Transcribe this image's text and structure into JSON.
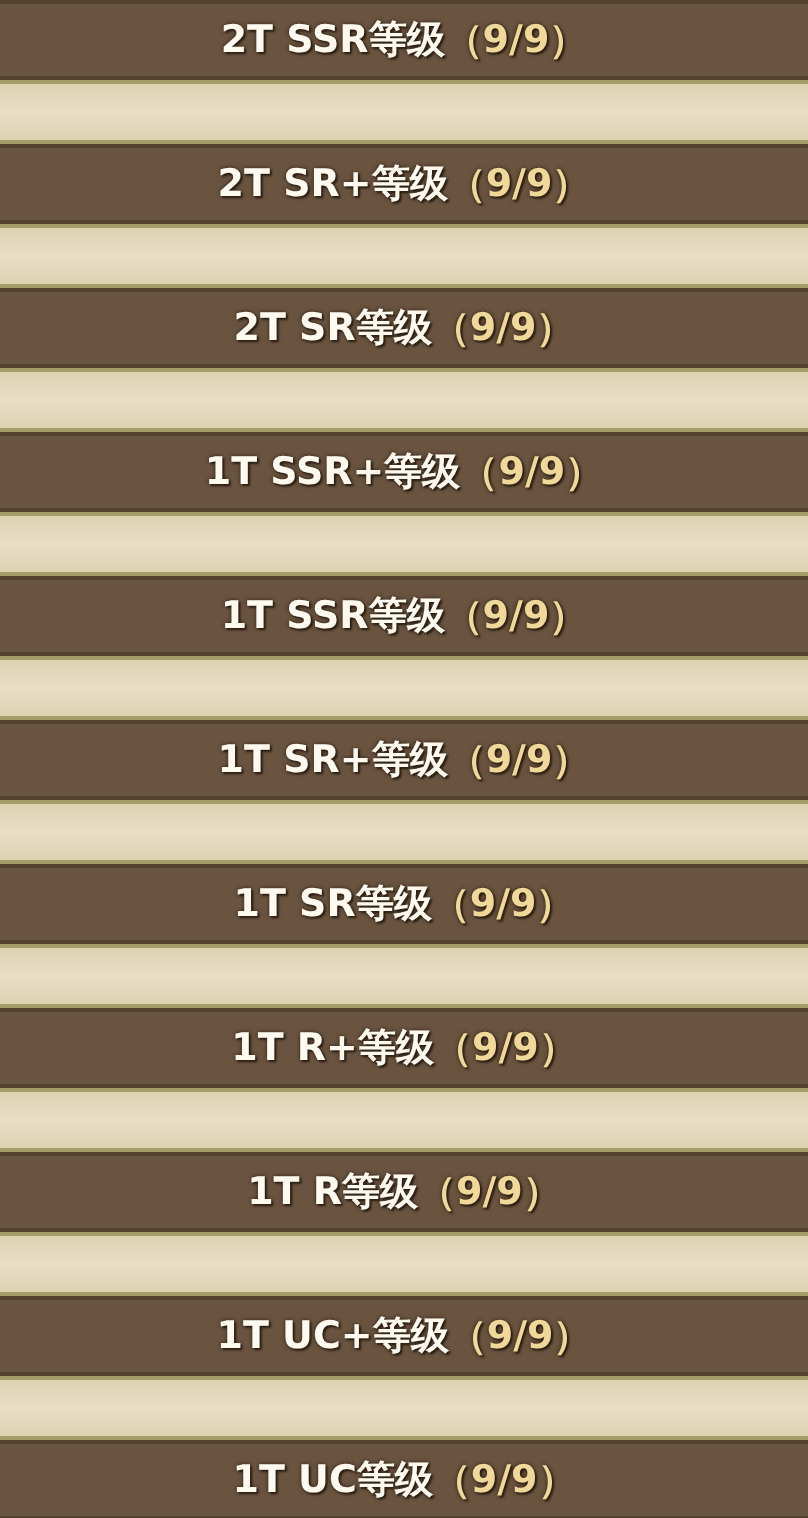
{
  "rows": [
    {
      "label": "2T SSR等级",
      "count": "（9/9）"
    },
    {
      "label": "2T SR+等级",
      "count": "（9/9）"
    },
    {
      "label": "2T SR等级",
      "count": "（9/9）"
    },
    {
      "label": "1T SSR+等级",
      "count": "（9/9）"
    },
    {
      "label": "1T SSR等级",
      "count": "（9/9）"
    },
    {
      "label": "1T SR+等级",
      "count": "（9/9）"
    },
    {
      "label": "1T SR等级",
      "count": "（9/9）"
    },
    {
      "label": "1T R+等级",
      "count": "（9/9）"
    },
    {
      "label": "1T R等级",
      "count": "（9/9）"
    },
    {
      "label": "1T UC+等级",
      "count": "（9/9）"
    },
    {
      "label": "1T UC等级",
      "count": "（9/9）"
    }
  ]
}
